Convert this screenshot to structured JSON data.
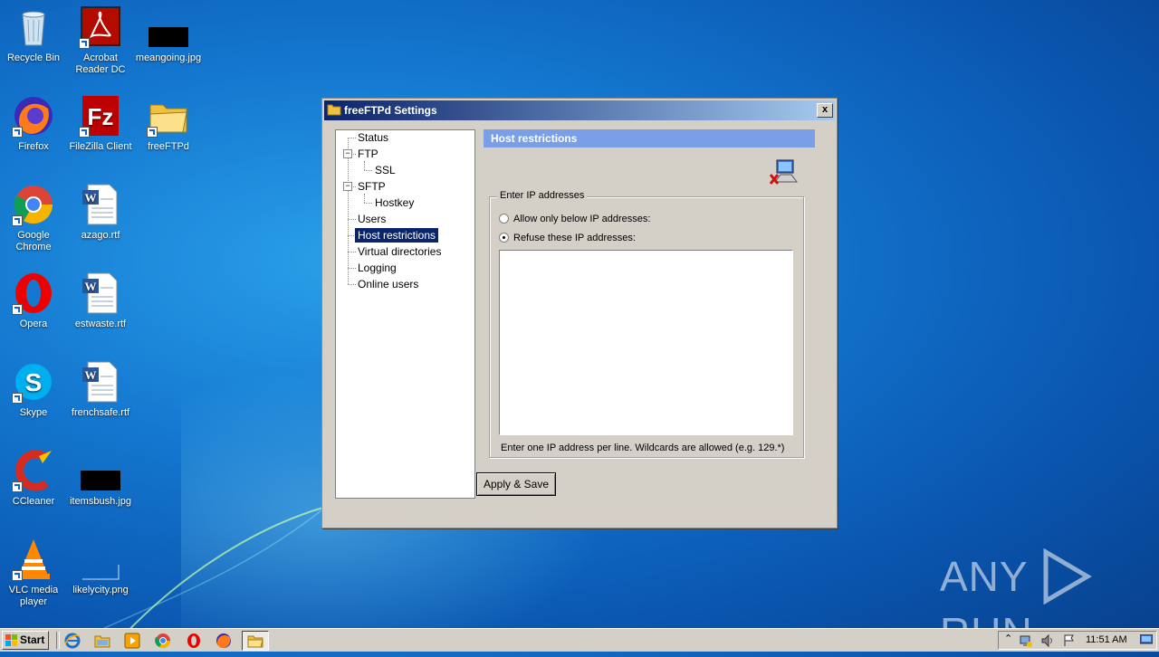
{
  "desktop": {
    "icons": [
      {
        "label": "Recycle Bin",
        "icon": "recycle-bin-icon"
      },
      {
        "label": "Acrobat Reader DC",
        "icon": "acrobat-icon"
      },
      {
        "label": "meangoing.jpg",
        "icon": "image-file-icon"
      },
      {
        "label": "Firefox",
        "icon": "firefox-icon"
      },
      {
        "label": "FileZilla Client",
        "icon": "filezilla-icon"
      },
      {
        "label": "freeFTPd",
        "icon": "folder-icon"
      },
      {
        "label": "Google Chrome",
        "icon": "chrome-icon"
      },
      {
        "label": "azago.rtf",
        "icon": "word-doc-icon"
      },
      {
        "label": "Opera",
        "icon": "opera-icon"
      },
      {
        "label": "estwaste.rtf",
        "icon": "word-doc-icon"
      },
      {
        "label": "Skype",
        "icon": "skype-icon"
      },
      {
        "label": "frenchsafe.rtf",
        "icon": "word-doc-icon"
      },
      {
        "label": "CCleaner",
        "icon": "ccleaner-icon"
      },
      {
        "label": "itemsbush.jpg",
        "icon": "image-file-icon"
      },
      {
        "label": "VLC media player",
        "icon": "vlc-icon"
      },
      {
        "label": "likelycity.png",
        "icon": "image-file-icon"
      }
    ]
  },
  "dialog": {
    "title": "freeFTPd Settings",
    "close_label": "x",
    "tree": {
      "items": [
        {
          "label": "Status"
        },
        {
          "label": "FTP"
        },
        {
          "label": "SSL"
        },
        {
          "label": "SFTP"
        },
        {
          "label": "Hostkey"
        },
        {
          "label": "Users"
        },
        {
          "label": "Host restrictions"
        },
        {
          "label": "Virtual directories"
        },
        {
          "label": "Logging"
        },
        {
          "label": "Online users"
        }
      ],
      "selected": "Host restrictions"
    },
    "panel": {
      "header": "Host restrictions",
      "group_title": "Enter IP addresses",
      "option_allow": "Allow only below IP addresses:",
      "option_refuse": "Refuse these IP addresses:",
      "selected_option": "refuse",
      "ip_list_value": "",
      "hint": "Enter one IP address per line. Wildcards are allowed (e.g. 129.*)"
    },
    "apply_label": "Apply & Save"
  },
  "taskbar": {
    "start_label": "Start",
    "pinned": [
      "internet-explorer-icon",
      "explorer-icon",
      "media-player-icon",
      "chrome-icon",
      "opera-icon",
      "firefox-icon",
      "freeftpd-icon"
    ],
    "clock": "11:51 AM"
  },
  "watermark": {
    "left": "ANY",
    "right": "RUN"
  }
}
